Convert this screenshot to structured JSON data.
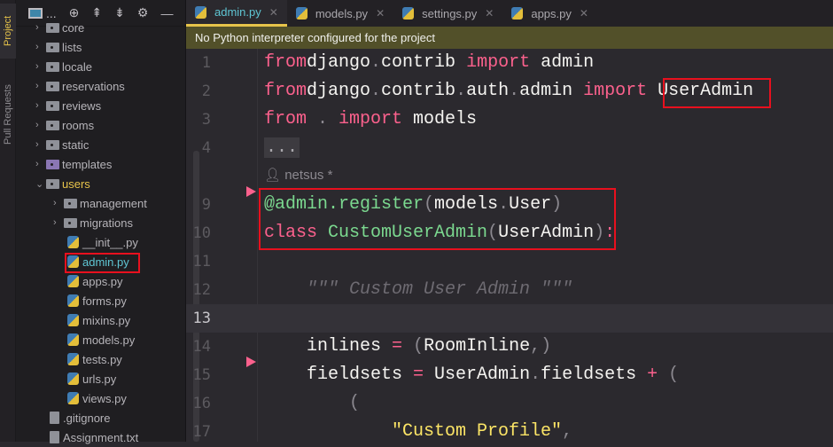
{
  "sidebar_stripe": {
    "project": "Project",
    "pull_requests": "Pull Requests"
  },
  "project_toolbar": {
    "more": "...",
    "icons": [
      "panel-icon",
      "locate-icon",
      "expand-all-icon",
      "collapse-all-icon",
      "gear-icon",
      "minimize-icon"
    ]
  },
  "tree": [
    {
      "label": "core",
      "type": "folder",
      "level": 1
    },
    {
      "label": "lists",
      "type": "folder",
      "level": 1
    },
    {
      "label": "locale",
      "type": "folder",
      "level": 1
    },
    {
      "label": "reservations",
      "type": "folder",
      "level": 1
    },
    {
      "label": "reviews",
      "type": "folder",
      "level": 1
    },
    {
      "label": "rooms",
      "type": "folder",
      "level": 1
    },
    {
      "label": "static",
      "type": "folder",
      "level": 1
    },
    {
      "label": "templates",
      "type": "folder",
      "level": 1
    },
    {
      "label": "users",
      "type": "folder",
      "level": 1,
      "open": true
    },
    {
      "label": "management",
      "type": "folder",
      "level": 2
    },
    {
      "label": "migrations",
      "type": "folder",
      "level": 2
    },
    {
      "label": "__init__.py",
      "type": "py",
      "level": 2
    },
    {
      "label": "admin.py",
      "type": "py",
      "level": 2,
      "selected": true
    },
    {
      "label": "apps.py",
      "type": "py",
      "level": 2
    },
    {
      "label": "forms.py",
      "type": "py",
      "level": 2
    },
    {
      "label": "mixins.py",
      "type": "py",
      "level": 2
    },
    {
      "label": "models.py",
      "type": "py",
      "level": 2
    },
    {
      "label": "tests.py",
      "type": "py",
      "level": 2
    },
    {
      "label": "urls.py",
      "type": "py",
      "level": 2
    },
    {
      "label": "views.py",
      "type": "py",
      "level": 2
    },
    {
      "label": ".gitignore",
      "type": "txt",
      "level": 1
    },
    {
      "label": "Assignment.txt",
      "type": "txt",
      "level": 1
    }
  ],
  "tabs": [
    {
      "label": "admin.py",
      "active": true
    },
    {
      "label": "models.py"
    },
    {
      "label": "settings.py"
    },
    {
      "label": "apps.py"
    }
  ],
  "banner": "No Python interpreter configured for the project",
  "author": "netsus *",
  "lines": [
    {
      "n": "1",
      "tokens": [
        [
          "kw",
          "from"
        ],
        [
          "",
          "django"
        ],
        [
          "punc",
          "."
        ],
        [
          "",
          "contrib "
        ],
        [
          "kw",
          "import"
        ],
        [
          "",
          " admin"
        ]
      ]
    },
    {
      "n": "2",
      "tokens": [
        [
          "kw",
          "from"
        ],
        [
          "",
          "django"
        ],
        [
          "punc",
          "."
        ],
        [
          "",
          "contrib"
        ],
        [
          "punc",
          "."
        ],
        [
          "",
          "auth"
        ],
        [
          "punc",
          "."
        ],
        [
          "",
          "admin "
        ],
        [
          "kw",
          "import"
        ],
        [
          "",
          " UserAdmin"
        ]
      ]
    },
    {
      "n": "3",
      "tokens": [
        [
          "kw",
          "from"
        ],
        [
          "punc",
          " . "
        ],
        [
          "kw",
          "import"
        ],
        [
          "",
          " models"
        ]
      ]
    },
    {
      "n": "4",
      "tokens": [
        [
          "dots",
          "..."
        ]
      ]
    },
    {
      "n": "9",
      "tokens": [
        [
          "fn",
          "@admin.register"
        ],
        [
          "punc",
          "("
        ],
        [
          "",
          "models"
        ],
        [
          "punc",
          "."
        ],
        [
          "",
          "User"
        ],
        [
          "punc",
          ")"
        ]
      ]
    },
    {
      "n": "10",
      "tokens": [
        [
          "kw",
          "class "
        ],
        [
          "fn",
          "CustomUserAdmin"
        ],
        [
          "punc",
          "("
        ],
        [
          "",
          "UserAdmin"
        ],
        [
          "punc",
          ")"
        ],
        [
          "kw",
          ":"
        ]
      ]
    },
    {
      "n": "11",
      "tokens": []
    },
    {
      "n": "12",
      "tokens": [
        [
          "doc",
          "    \"\"\" Custom User Admin \"\"\""
        ]
      ]
    },
    {
      "n": "13",
      "tokens": [],
      "current": true
    },
    {
      "n": "14",
      "tokens": [
        [
          "",
          "    inlines "
        ],
        [
          "op",
          "="
        ],
        [
          "punc",
          " ("
        ],
        [
          "",
          "RoomInline"
        ],
        [
          "punc",
          ",)"
        ]
      ]
    },
    {
      "n": "15",
      "tokens": [
        [
          "",
          "    fieldsets "
        ],
        [
          "op",
          "="
        ],
        [
          "",
          " UserAdmin"
        ],
        [
          "punc",
          "."
        ],
        [
          "",
          "fieldsets "
        ],
        [
          "op",
          "+"
        ],
        [
          "punc",
          " ("
        ]
      ]
    },
    {
      "n": "16",
      "tokens": [
        [
          "punc",
          "        ("
        ]
      ]
    },
    {
      "n": "17",
      "tokens": [
        [
          "str",
          "            \"Custom Profile\""
        ],
        [
          "punc",
          ","
        ]
      ]
    }
  ],
  "colors": {
    "keyword": "#fc618d",
    "function": "#7bd88f",
    "string": "#fce566",
    "accent": "#e6c34a",
    "highlight": "#e8101e"
  }
}
